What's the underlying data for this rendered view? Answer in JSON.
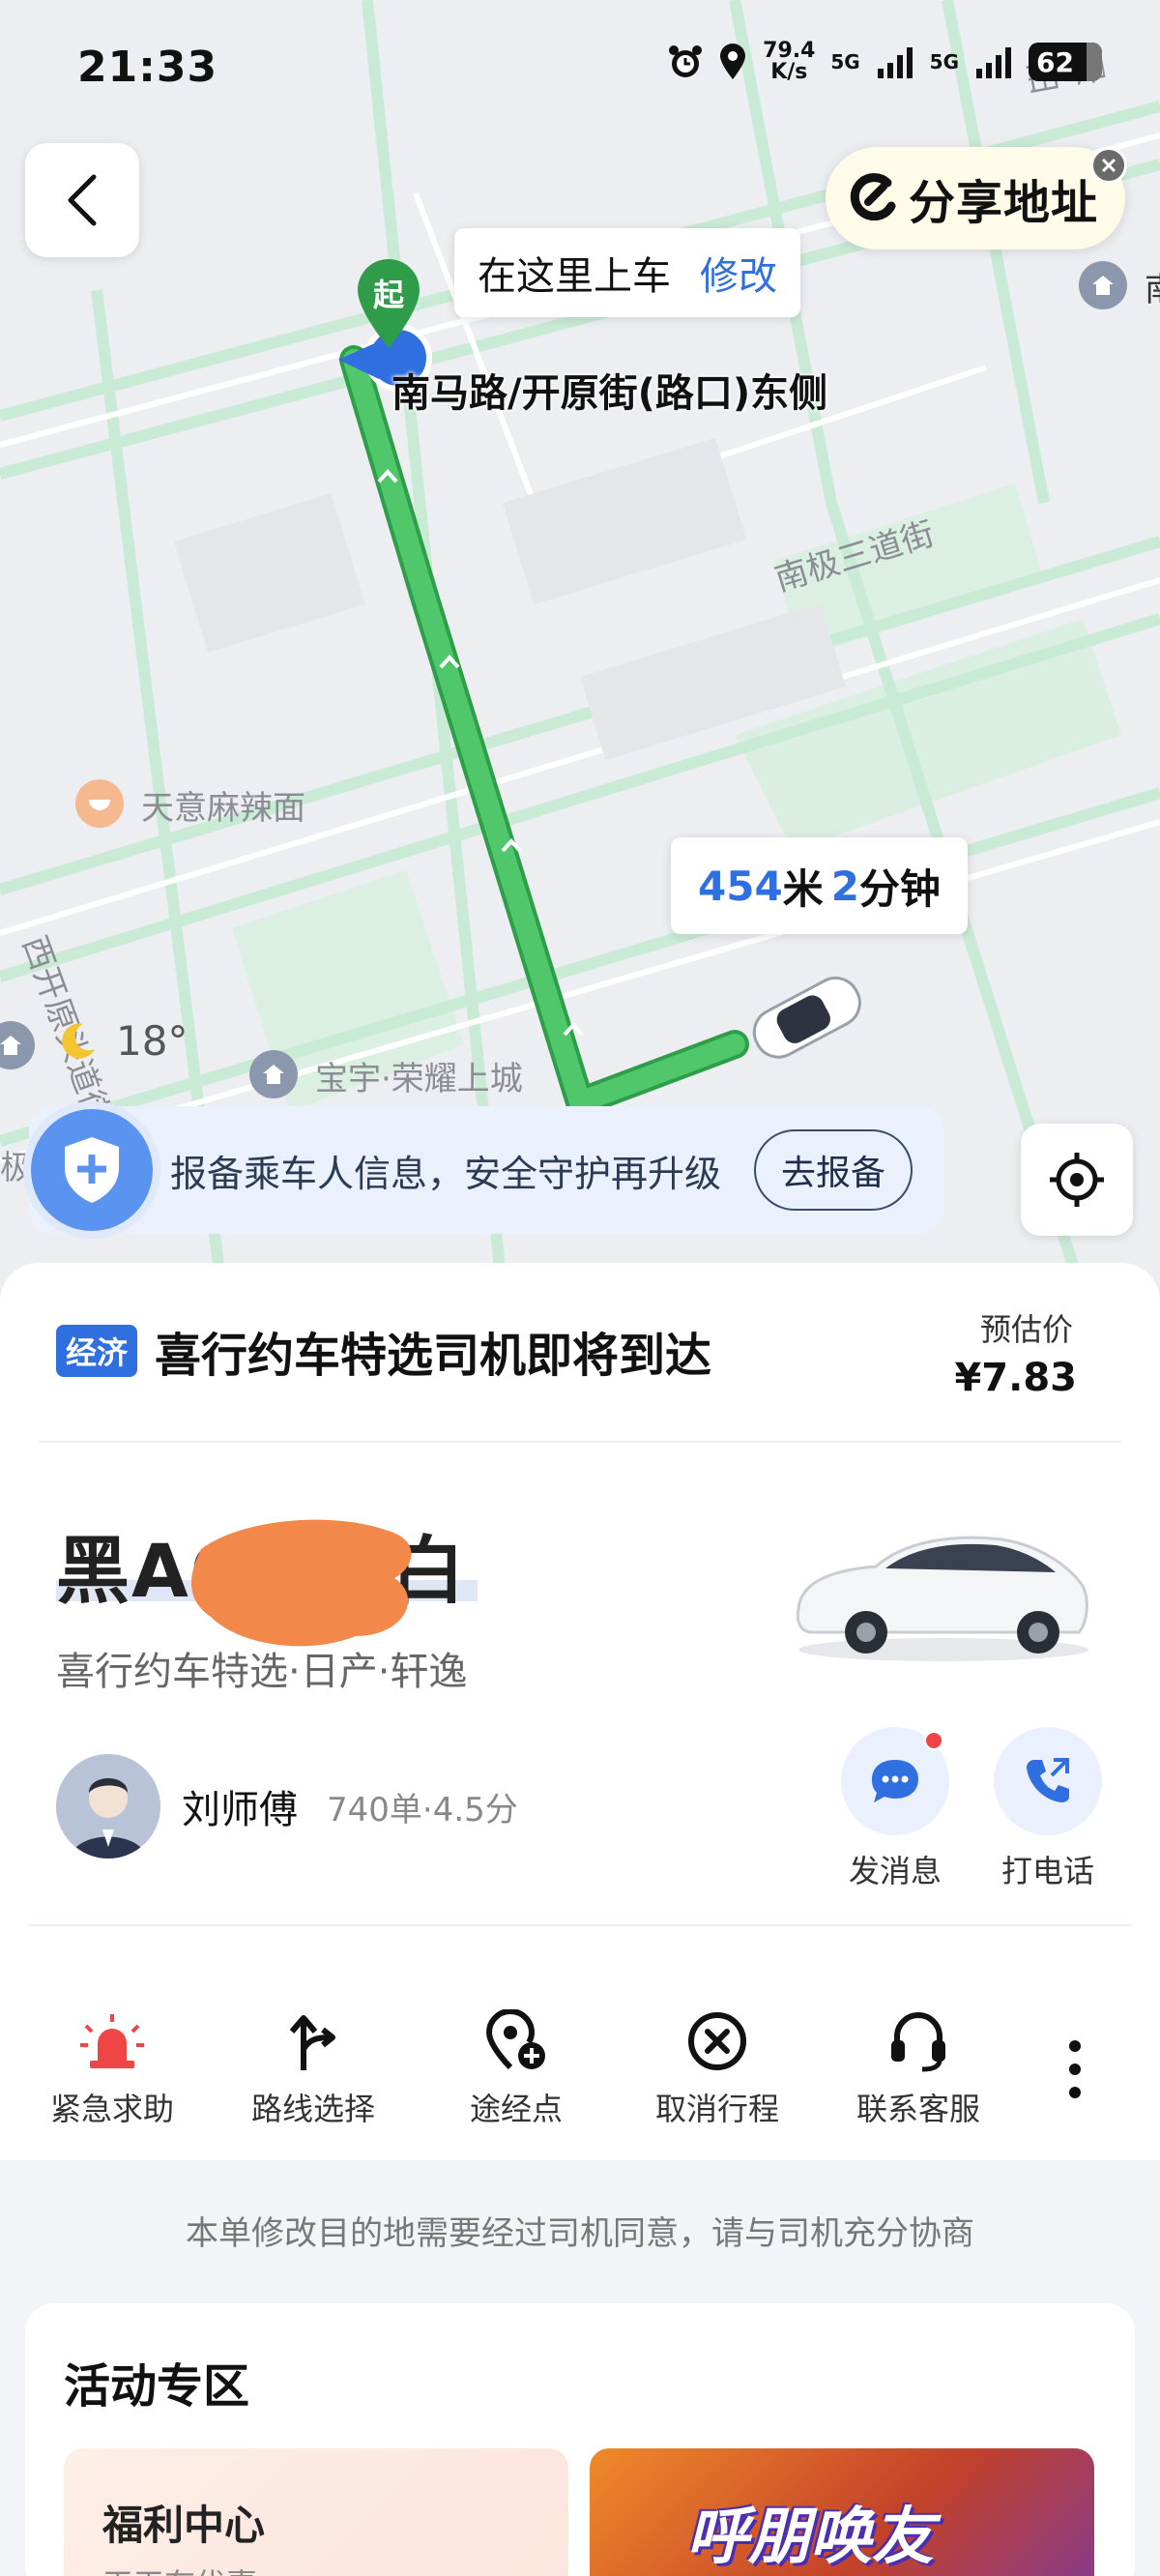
{
  "status_bar": {
    "time": "21:33",
    "net_speed": "79.4 K/s",
    "sim1": "5G",
    "sim2": "5G",
    "battery": "62"
  },
  "map": {
    "share_label": "分享地址",
    "pickup_prompt": "在这里上车",
    "pickup_edit": "修改",
    "start_marker": "起",
    "pickup_name": "南马路/开原街(路口)东侧",
    "eta_distance": "454",
    "eta_distance_unit": "米",
    "eta_minutes": "2",
    "eta_minutes_unit": "分钟",
    "labels": {
      "street1": "南极三道街",
      "street2": "西开原头道街",
      "poi1": "天意麻辣面",
      "poi2": "宝宇·荣耀上城",
      "edge_top": "景阳",
      "edge_right": "南",
      "edge_left": "极"
    },
    "temperature": "18°",
    "route_color": "#3dbb5a",
    "accent": "#2f6fe0"
  },
  "safety": {
    "text": "报备乘车人信息，安全守护再升级",
    "button": "去报备"
  },
  "order": {
    "tag": "经济",
    "title": "喜行约车特选司机即将到达",
    "price_label": "预估价",
    "price": "¥7.83",
    "plate_prefix": "黑AC",
    "plate_suffix": "白",
    "car_model": "喜行约车特选·日产·轩逸",
    "driver_name": "刘师傅",
    "driver_meta": "740单·4.5分",
    "message_label": "发消息",
    "call_label": "打电话"
  },
  "tools": [
    {
      "label": "紧急求助",
      "icon": "siren-icon"
    },
    {
      "label": "路线选择",
      "icon": "route-split-icon"
    },
    {
      "label": "途经点",
      "icon": "waypoint-add-icon"
    },
    {
      "label": "取消行程",
      "icon": "cancel-circle-icon"
    },
    {
      "label": "联系客服",
      "icon": "headset-icon"
    }
  ],
  "notice": "本单修改目的地需要经过司机同意，请与司机充分协商",
  "activity": {
    "title": "活动专区",
    "card1_title": "福利中心",
    "card1_sub": "天天有优惠",
    "card2_text": "呼朋唤友"
  }
}
